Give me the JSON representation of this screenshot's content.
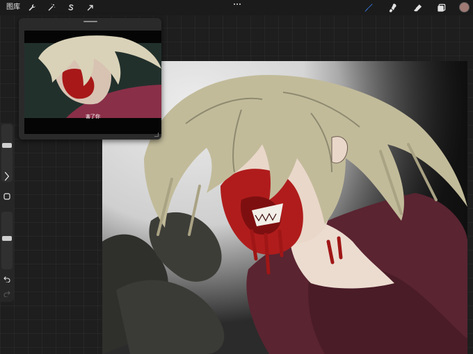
{
  "toolbar": {
    "gallery_label": "图库",
    "adjustments": [
      {
        "name": "actions-wrench-icon"
      },
      {
        "name": "adjustments-magic-wand-icon"
      },
      {
        "name": "selection-s-icon"
      },
      {
        "name": "transform-arrow-icon"
      }
    ],
    "more_icon": "more-dots-icon",
    "tools": [
      {
        "name": "brush-icon",
        "active": true
      },
      {
        "name": "smudge-icon",
        "active": false
      },
      {
        "name": "eraser-icon",
        "active": false
      },
      {
        "name": "layers-icon",
        "active": false
      }
    ],
    "current_color": "#a07a74",
    "active_tool_color": "#3b82f6"
  },
  "reference_window": {
    "subtitle": "害了你"
  },
  "sidebar": {
    "brush_size_level": 0.35,
    "opacity_level": 0.45,
    "expand_icon": "chevron-right-icon",
    "modify_icon": "square-modify-icon",
    "undo_icon": "undo-icon",
    "redo_icon": "redo-icon"
  },
  "canvas": {
    "subject": "artwork"
  }
}
